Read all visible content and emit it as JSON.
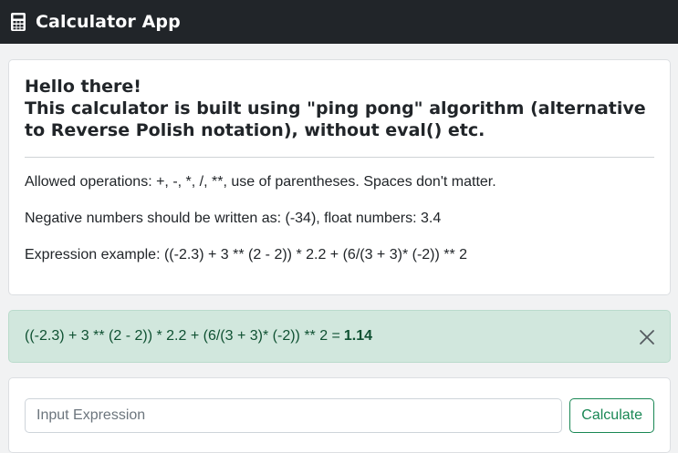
{
  "app": {
    "title": "Calculator App",
    "icon": "calculator-icon"
  },
  "intro": {
    "headline_line1": "Hello there!",
    "headline_line2": "This calculator is built using \"ping pong\" algorithm (alternative to Reverse Polish notation), without eval() etc.",
    "allowed_ops": "Allowed operations: +, -, *, /, **, use of parentheses. Spaces don't matter.",
    "negative_numbers": "Negative numbers should be written as: (-34), float numbers: 3.4",
    "example": "Expression example: ((-2.3) + 3 ** (2 - 2)) * 2.2 + (6/(3 + 3)* (-2)) ** 2"
  },
  "result": {
    "expression": "((-2.3) + 3 ** (2 - 2)) * 2.2 + (6/(3 + 3)* (-2)) ** 2 =",
    "value": "1.14",
    "close_icon": "close-icon",
    "color": "#0f5132",
    "background": "#d1e7dd"
  },
  "form": {
    "input_placeholder": "Input Expression",
    "input_value": "",
    "button_label": "Calculate",
    "button_color": "#198754"
  }
}
